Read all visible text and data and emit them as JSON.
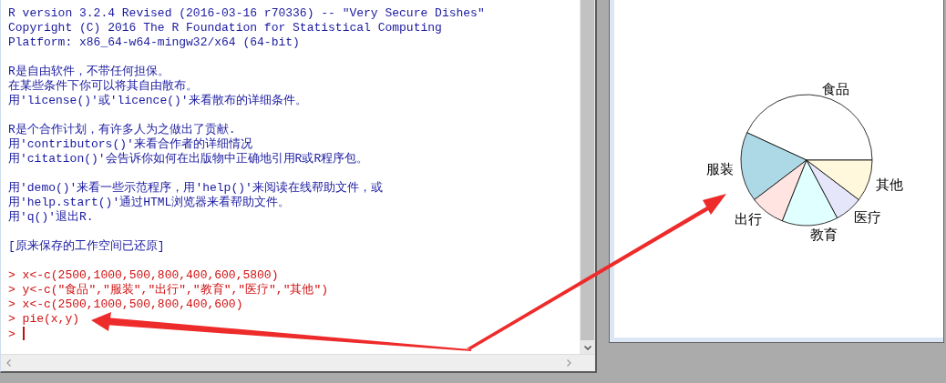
{
  "console": {
    "paragraphs": [
      {
        "lines": [
          {
            "kind": "output",
            "text": "R version 3.2.4 Revised (2016-03-16 r70336) -- \"Very Secure Dishes\""
          },
          {
            "kind": "output",
            "text": "Copyright (C) 2016 The R Foundation for Statistical Computing"
          },
          {
            "kind": "output",
            "text": "Platform: x86_64-w64-mingw32/x64 (64-bit)"
          }
        ]
      },
      {
        "lines": [
          {
            "kind": "output",
            "text": "R是自由软件，不带任何担保。"
          },
          {
            "kind": "output",
            "text": "在某些条件下你可以将其自由散布。"
          },
          {
            "kind": "output",
            "text": "用'license()'或'licence()'来看散布的详细条件。"
          }
        ]
      },
      {
        "lines": [
          {
            "kind": "output",
            "text": "R是个合作计划，有许多人为之做出了贡献."
          },
          {
            "kind": "output",
            "text": "用'contributors()'来看合作者的详细情况"
          },
          {
            "kind": "output",
            "text": "用'citation()'会告诉你如何在出版物中正确地引用R或R程序包。"
          }
        ]
      },
      {
        "lines": [
          {
            "kind": "output",
            "text": "用'demo()'来看一些示范程序，用'help()'来阅读在线帮助文件，或"
          },
          {
            "kind": "output",
            "text": "用'help.start()'通过HTML浏览器来看帮助文件。"
          },
          {
            "kind": "output",
            "text": "用'q()'退出R."
          }
        ]
      },
      {
        "lines": [
          {
            "kind": "output",
            "text": "[原来保存的工作空间已还原]"
          }
        ]
      },
      {
        "lines": [
          {
            "kind": "input",
            "prompt": ">",
            "text": "x<-c(2500,1000,500,800,400,600,5800)"
          },
          {
            "kind": "input",
            "prompt": ">",
            "text": "y<-c(\"食品\",\"服装\",\"出行\",\"教育\",\"医疗\",\"其他\")"
          },
          {
            "kind": "input",
            "prompt": ">",
            "text": "x<-c(2500,1000,500,800,400,600)"
          },
          {
            "kind": "input",
            "prompt": ">",
            "text": "pie(x,y)"
          },
          {
            "kind": "cursor",
            "prompt": ">"
          }
        ]
      }
    ]
  },
  "graphics": {
    "chart_data": {
      "type": "pie",
      "categories": [
        "食品",
        "服装",
        "出行",
        "教育",
        "医疗",
        "其他"
      ],
      "values": [
        43.11,
        17.24,
        8.62,
        13.79,
        6.9,
        10.34
      ],
      "colors": [
        "#ffffff",
        "#add8e6",
        "#ffe4e1",
        "#e0ffff",
        "#e6e6fa",
        "#fff8dc"
      ]
    }
  }
}
